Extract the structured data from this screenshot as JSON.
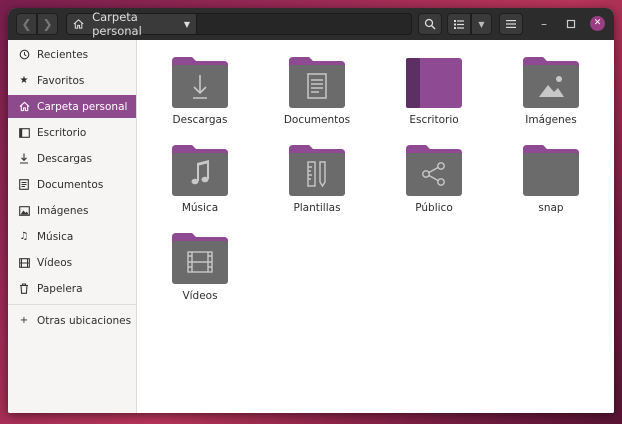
{
  "header": {
    "path_label": "Carpeta personal"
  },
  "sidebar": {
    "items": [
      {
        "label": "Recientes",
        "icon": "clock-icon"
      },
      {
        "label": "Favoritos",
        "icon": "star-icon"
      },
      {
        "label": "Carpeta personal",
        "icon": "home-icon",
        "active": true
      },
      {
        "label": "Escritorio",
        "icon": "desktop-icon"
      },
      {
        "label": "Descargas",
        "icon": "download-icon"
      },
      {
        "label": "Documentos",
        "icon": "document-icon"
      },
      {
        "label": "Imágenes",
        "icon": "image-icon"
      },
      {
        "label": "Música",
        "icon": "music-icon"
      },
      {
        "label": "Vídeos",
        "icon": "video-icon"
      },
      {
        "label": "Papelera",
        "icon": "trash-icon"
      }
    ],
    "other_locations": {
      "label": "Otras ubicaciones",
      "icon": "plus-icon"
    }
  },
  "folders": [
    {
      "label": "Descargas",
      "icon": "download-icon"
    },
    {
      "label": "Documentos",
      "icon": "document-icon"
    },
    {
      "label": "Escritorio",
      "icon": "desktop-icon"
    },
    {
      "label": "Imágenes",
      "icon": "image-icon"
    },
    {
      "label": "Música",
      "icon": "music-icon"
    },
    {
      "label": "Plantillas",
      "icon": "template-icon"
    },
    {
      "label": "Público",
      "icon": "share-icon"
    },
    {
      "label": "snap",
      "icon": ""
    },
    {
      "label": "Vídeos",
      "icon": "video-icon"
    }
  ],
  "colors": {
    "accent": "#8d4b8d",
    "folder_tab": "#8e4a93",
    "folder_body": "#6b6b6b",
    "close_button": "#9b3d82"
  }
}
